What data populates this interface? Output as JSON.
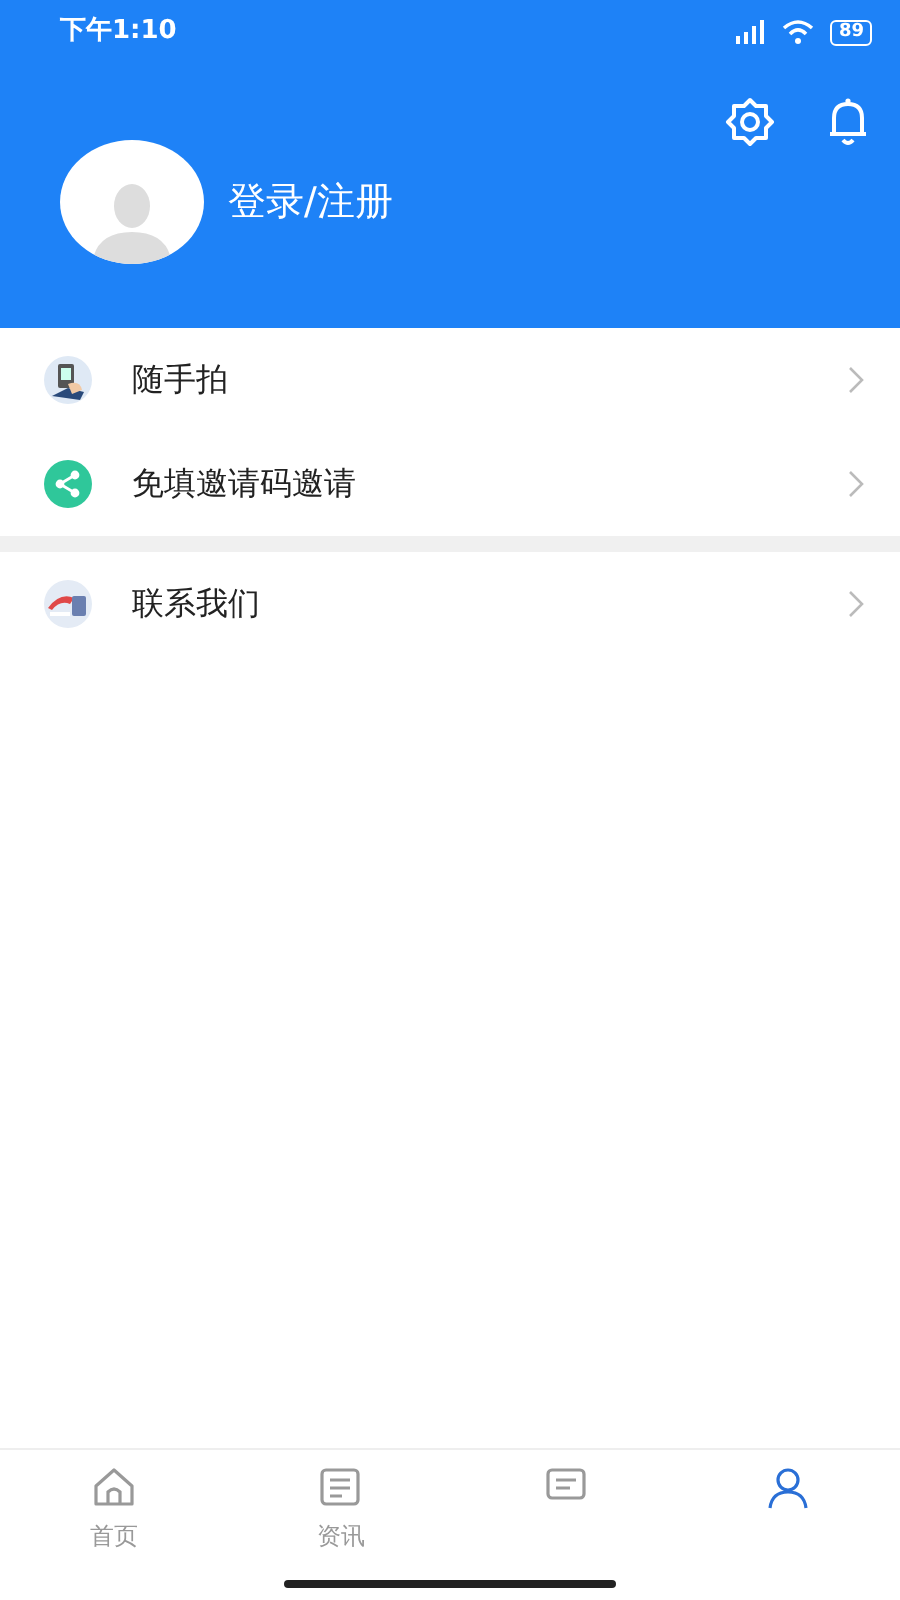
{
  "status_bar": {
    "time": "下午1:10",
    "battery": "89"
  },
  "header": {
    "login_label": "登录/注册"
  },
  "menu_groups": [
    {
      "items": [
        {
          "label": "随手拍",
          "kind": "photo"
        },
        {
          "label": "免填邀请码邀请",
          "kind": "share"
        }
      ]
    },
    {
      "items": [
        {
          "label": "联系我们",
          "kind": "contact"
        }
      ]
    }
  ],
  "tab_bar": [
    {
      "label": "首页",
      "kind": "home",
      "selected": false
    },
    {
      "label": "资讯",
      "kind": "news",
      "selected": false
    },
    {
      "kind": "message",
      "selected": false
    },
    {
      "kind": "person",
      "selected": true
    }
  ]
}
